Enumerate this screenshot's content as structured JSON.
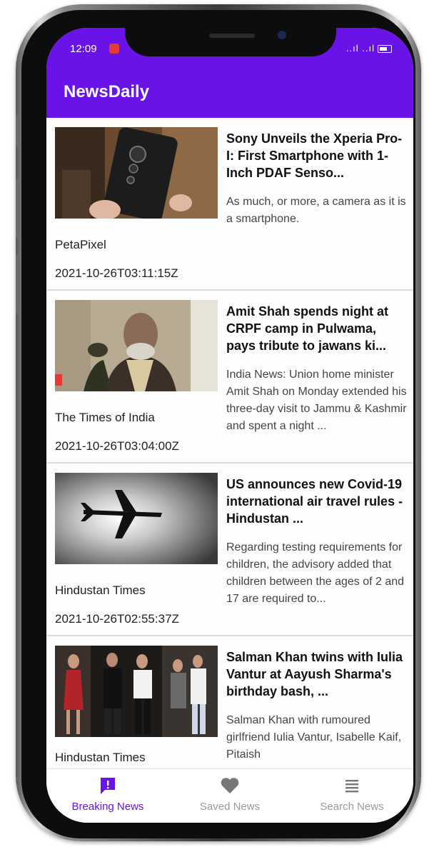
{
  "status_bar": {
    "time": "12:09",
    "signal_text": "..ıl ..ıl"
  },
  "app": {
    "title": "NewsDaily"
  },
  "articles": [
    {
      "title": "Sony Unveils the Xperia Pro-I: First Smartphone with 1-Inch PDAF Senso...",
      "description": "As much, or more, a camera as it is a smartphone.",
      "source": "PetaPixel",
      "published_at": "2021-10-26T03:11:15Z"
    },
    {
      "title": "Amit Shah spends night at CRPF camp in Pulwama, pays tribute to jawans ki...",
      "description": "India News: Union home minister Amit Shah on Monday extended his three-day visit to Jammu & Kashmir and spent a night ...",
      "source": "The Times of India",
      "published_at": "2021-10-26T03:04:00Z"
    },
    {
      "title": "US announces new Covid-19 international air travel rules - Hindustan ...",
      "description": "Regarding testing requirements for children, the advisory added that children between the ages of 2 and 17 are required to...",
      "source": "Hindustan Times",
      "published_at": "2021-10-26T02:55:37Z"
    },
    {
      "title": "Salman Khan twins with Iulia Vantur at Aayush Sharma's birthday bash, ...",
      "description": "Salman Khan with rumoured girlfriend Iulia Vantur, Isabelle Kaif, Pitaish",
      "source": "Hindustan Times",
      "published_at": ""
    }
  ],
  "bottom_nav": [
    {
      "label": "Breaking News",
      "icon": "breaking-news-icon",
      "active": true
    },
    {
      "label": "Saved News",
      "icon": "heart-icon",
      "active": false
    },
    {
      "label": "Search News",
      "icon": "menu-lines-icon",
      "active": false
    }
  ],
  "colors": {
    "accent": "#6a13e8",
    "inactive": "#9a9a9a"
  }
}
